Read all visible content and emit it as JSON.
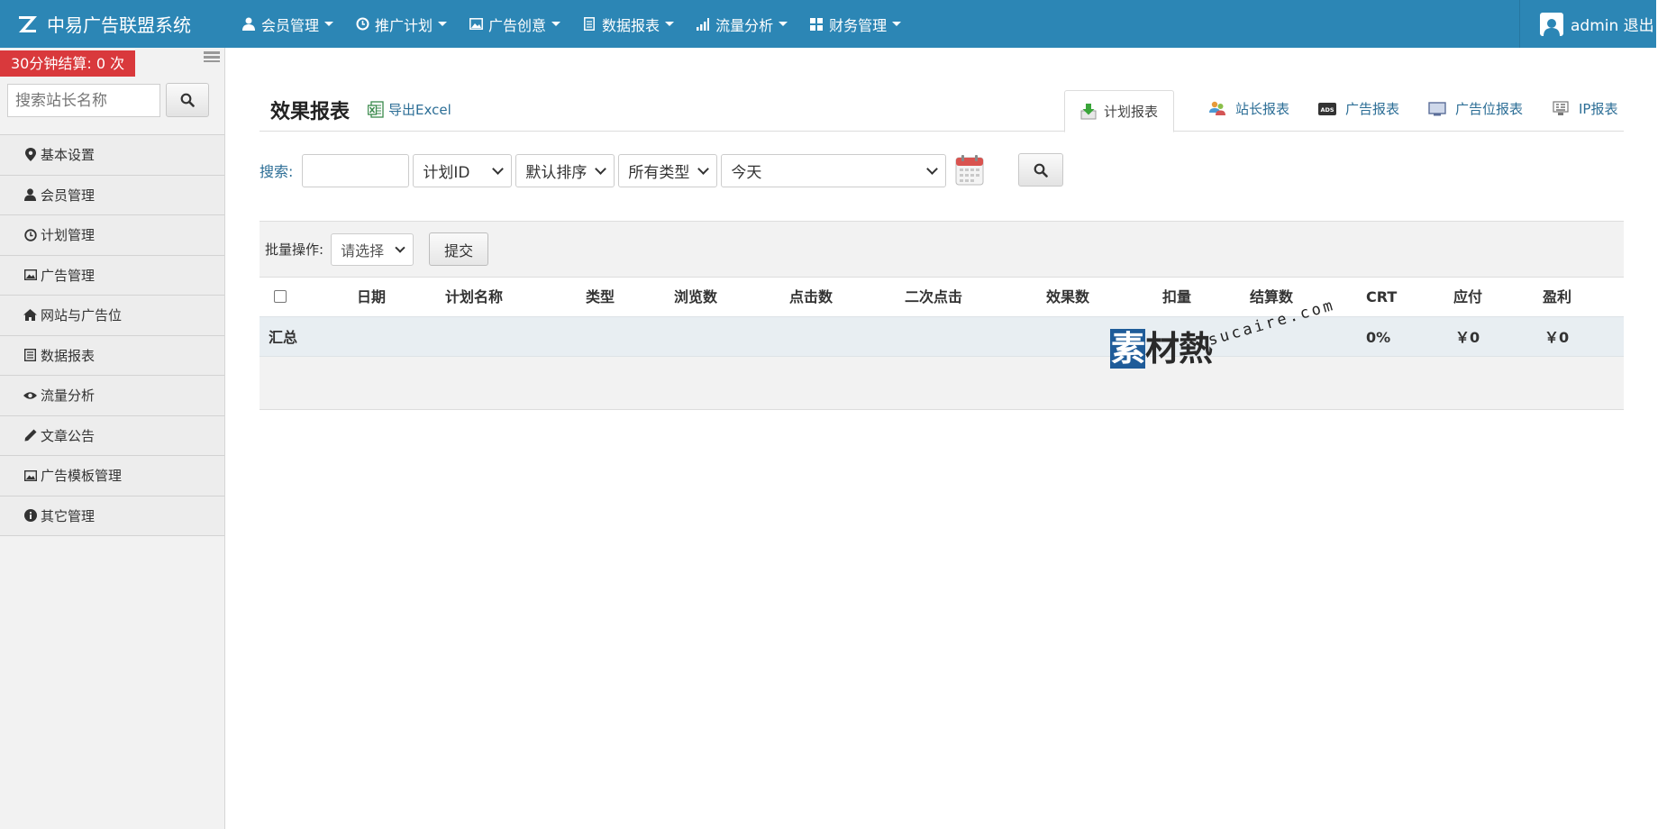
{
  "app": {
    "title": "中易广告联盟系统"
  },
  "nav": {
    "items": [
      {
        "label": "会员管理",
        "icon": "user-icon"
      },
      {
        "label": "推广计划",
        "icon": "clock-icon"
      },
      {
        "label": "广告创意",
        "icon": "image-icon"
      },
      {
        "label": "数据报表",
        "icon": "document-icon"
      },
      {
        "label": "流量分析",
        "icon": "signal-icon"
      },
      {
        "label": "财务管理",
        "icon": "grid-icon"
      }
    ]
  },
  "user": {
    "label": "admin 退出"
  },
  "sidebar": {
    "settle_badge": "30分钟结算: 0 次",
    "search_placeholder": "搜索站长名称",
    "items": [
      {
        "label": "基本设置",
        "icon": "map-pin-icon"
      },
      {
        "label": "会员管理",
        "icon": "user-icon"
      },
      {
        "label": "计划管理",
        "icon": "clock-icon"
      },
      {
        "label": "广告管理",
        "icon": "image-icon"
      },
      {
        "label": "网站与广告位",
        "icon": "home-icon"
      },
      {
        "label": "数据报表",
        "icon": "list-icon"
      },
      {
        "label": "流量分析",
        "icon": "eye-icon"
      },
      {
        "label": "文章公告",
        "icon": "pencil-icon"
      },
      {
        "label": "广告模板管理",
        "icon": "image-icon"
      },
      {
        "label": "其它管理",
        "icon": "info-icon"
      }
    ]
  },
  "main": {
    "title": "效果报表",
    "export_label": "导出Excel",
    "tabs": {
      "active": "计划报表",
      "links": [
        "站长报表",
        "广告报表",
        "广告位报表",
        "IP报表"
      ]
    },
    "filter": {
      "label": "搜索:",
      "input_value": "",
      "field_select": "计划ID",
      "sort_select": "默认排序",
      "type_select": "所有类型",
      "date_select": "今天"
    },
    "batch": {
      "label": "批量操作:",
      "select": "请选择",
      "submit": "提交"
    },
    "table": {
      "columns": [
        "日期",
        "计划名称",
        "类型",
        "浏览数",
        "点击数",
        "二次点击",
        "效果数",
        "扣量",
        "结算数",
        "CRT",
        "应付",
        "盈利"
      ],
      "summary": {
        "label": "汇总",
        "crt": "0%",
        "payable": "￥0",
        "profit": "￥0"
      }
    },
    "watermark": {
      "zh_first": "素",
      "zh_rest": "材熱",
      "en": "sucaire.com"
    }
  },
  "colors": {
    "topbar": "#2c86b5",
    "badge": "#d9393c",
    "link": "#2c6e96",
    "summary_row": "#e8eef2"
  }
}
